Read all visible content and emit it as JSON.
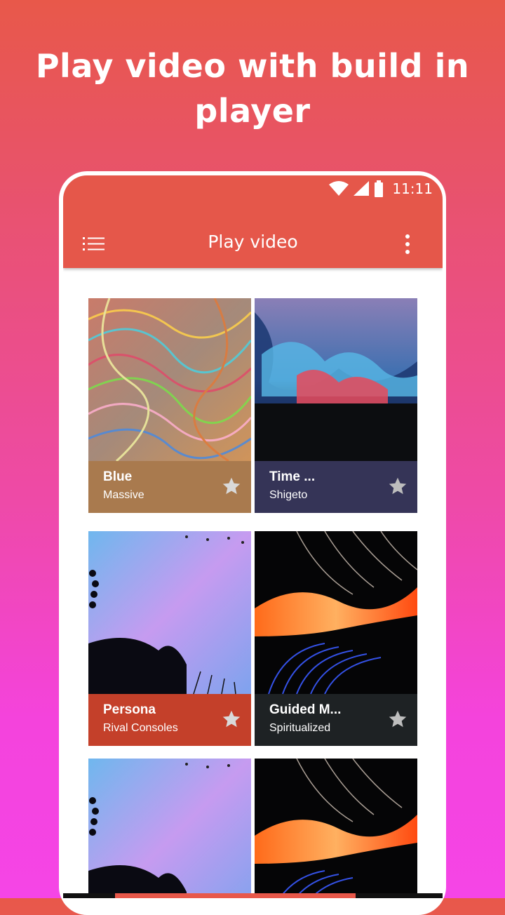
{
  "headline": "Play video with build in player",
  "status_bar": {
    "time": "11:11",
    "icons": [
      "wifi-icon",
      "cell-signal-icon",
      "battery-icon"
    ]
  },
  "toolbar": {
    "title": "Play video",
    "menu_icon": "list-menu-icon",
    "more_icon": "more-vert-icon"
  },
  "colors": {
    "accent": "#e5574a",
    "gradient_top": "#e8584a",
    "gradient_bottom": "#f545e6"
  },
  "cards": [
    {
      "title": "Blue",
      "subtitle": "Massive",
      "color": "#a97a4e",
      "art": "colorful-swirl"
    },
    {
      "title": "Time ...",
      "subtitle": "Shigeto",
      "color": "#353457",
      "art": "blue-red-ink"
    },
    {
      "title": "Persona",
      "subtitle": "Rival Consoles",
      "color": "#c4402a",
      "art": "silhouette-sky"
    },
    {
      "title": "Guided M...",
      "subtitle": "Spiritualized",
      "color": "#1e2224",
      "art": "neon-waves"
    },
    {
      "title": "",
      "subtitle": "",
      "color": "",
      "art": "silhouette-sky"
    },
    {
      "title": "",
      "subtitle": "",
      "color": "",
      "art": "neon-waves"
    }
  ]
}
